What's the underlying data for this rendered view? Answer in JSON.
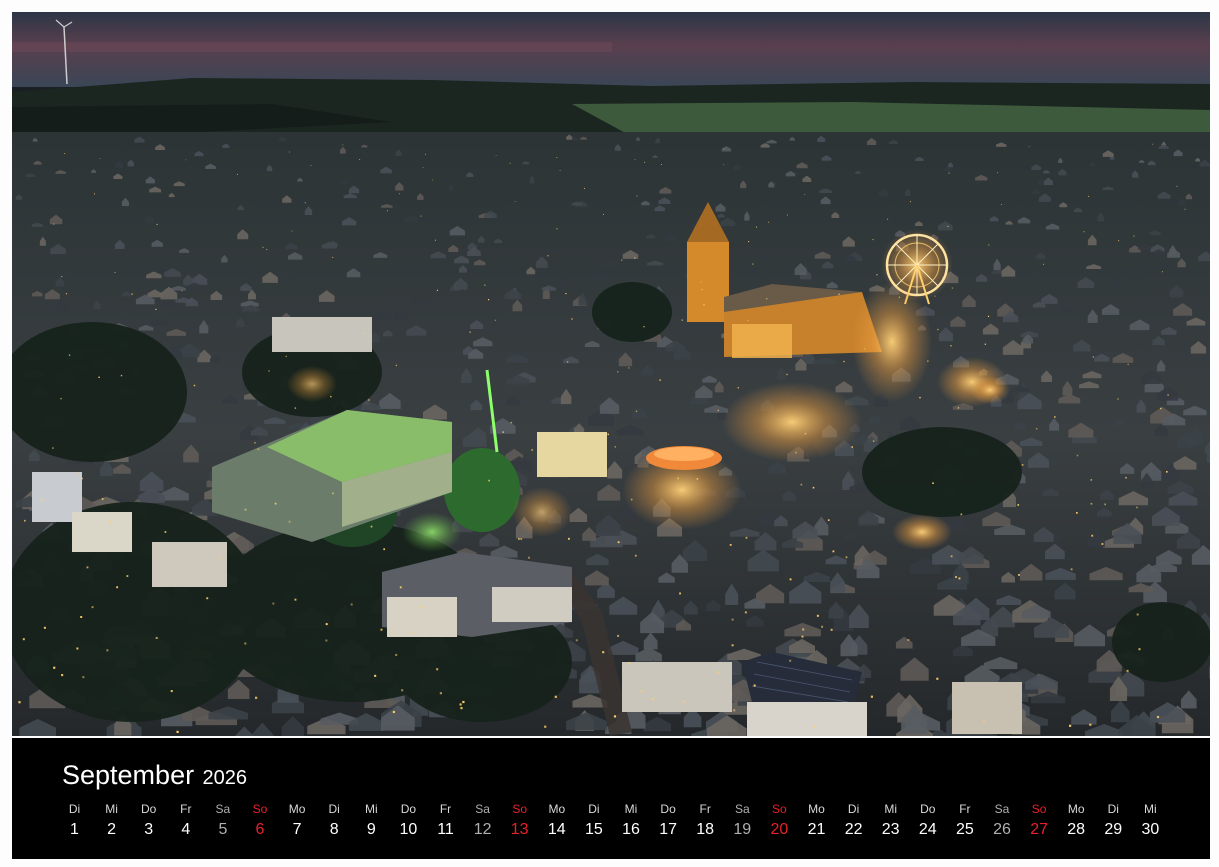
{
  "calendar": {
    "month": "September",
    "year": "2026",
    "weekend_color": "#e8202a",
    "days": [
      {
        "d": "Di",
        "n": "1"
      },
      {
        "d": "Mi",
        "n": "2"
      },
      {
        "d": "Do",
        "n": "3"
      },
      {
        "d": "Fr",
        "n": "4"
      },
      {
        "d": "Sa",
        "n": "5"
      },
      {
        "d": "So",
        "n": "6"
      },
      {
        "d": "Mo",
        "n": "7"
      },
      {
        "d": "Di",
        "n": "8"
      },
      {
        "d": "Mi",
        "n": "9"
      },
      {
        "d": "Do",
        "n": "10"
      },
      {
        "d": "Fr",
        "n": "11"
      },
      {
        "d": "Sa",
        "n": "12"
      },
      {
        "d": "So",
        "n": "13"
      },
      {
        "d": "Mo",
        "n": "14"
      },
      {
        "d": "Di",
        "n": "15"
      },
      {
        "d": "Mi",
        "n": "16"
      },
      {
        "d": "Do",
        "n": "17"
      },
      {
        "d": "Fr",
        "n": "18"
      },
      {
        "d": "Sa",
        "n": "19"
      },
      {
        "d": "So",
        "n": "20"
      },
      {
        "d": "Mo",
        "n": "21"
      },
      {
        "d": "Di",
        "n": "22"
      },
      {
        "d": "Mi",
        "n": "23"
      },
      {
        "d": "Do",
        "n": "24"
      },
      {
        "d": "Fr",
        "n": "25"
      },
      {
        "d": "Sa",
        "n": "26"
      },
      {
        "d": "So",
        "n": "27"
      },
      {
        "d": "Mo",
        "n": "28"
      },
      {
        "d": "Di",
        "n": "29"
      },
      {
        "d": "Mi",
        "n": "30"
      }
    ]
  },
  "photo": {
    "subject": "night-town-aerial"
  }
}
